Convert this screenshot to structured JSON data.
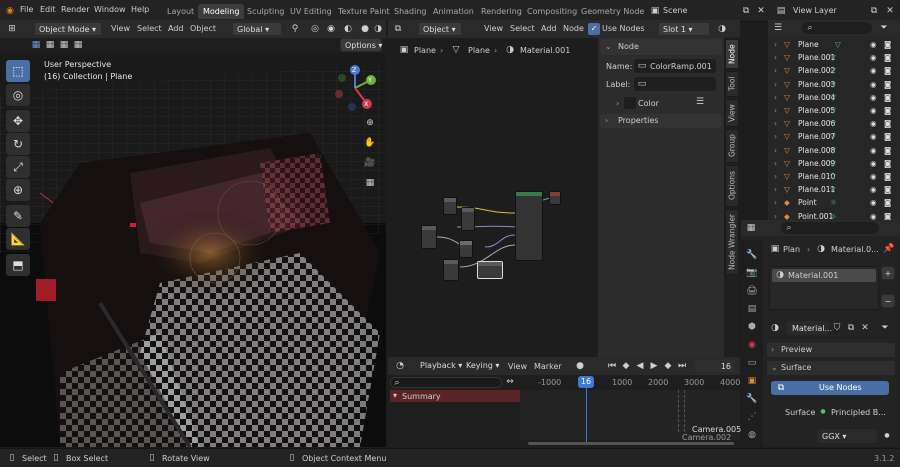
{
  "topbar": {
    "menus": [
      "File",
      "Edit",
      "Render",
      "Window",
      "Help"
    ],
    "workspaces": [
      "Layout",
      "Modeling",
      "Sculpting",
      "UV Editing",
      "Texture Paint",
      "Shading",
      "Animation",
      "Rendering",
      "Compositing",
      "Geometry Node"
    ],
    "active_workspace": "Modeling",
    "scene": "Scene",
    "view_layer": "View Layer"
  },
  "viewport": {
    "mode": "Object Mode",
    "menus": [
      "View",
      "Select",
      "Add",
      "Object"
    ],
    "transform": "Global",
    "options": "Options",
    "overlay_title": "User Perspective",
    "overlay_sub": "(16) Collection | Plane",
    "gizmo": {
      "x": "X",
      "y": "Y",
      "z": "Z"
    }
  },
  "node_editor": {
    "type": "Object",
    "menus": [
      "View",
      "Select",
      "Add",
      "Node"
    ],
    "use_nodes": "Use Nodes",
    "slot": "Slot 1",
    "breadcrumb": [
      "Plane",
      "Plane",
      "Material.001"
    ]
  },
  "npanel": {
    "section": "Node",
    "name_label": "Name:",
    "name_value": "ColorRamp.001",
    "label_label": "Label:",
    "label_value": "",
    "color": "Color",
    "properties": "Properties",
    "tabs": [
      "Node",
      "Tool",
      "View",
      "Group",
      "Options",
      "Node Wrangler"
    ]
  },
  "outliner": {
    "rows": [
      "Plane",
      "Plane.001",
      "Plane.002",
      "Plane.003",
      "Plane.004",
      "Plane.005",
      "Plane.006",
      "Plane.007",
      "Plane.008",
      "Plane.009",
      "Plane.010",
      "Plane.011",
      "Point",
      "Point.001"
    ]
  },
  "properties": {
    "breadcrumb_obj": "Plan",
    "breadcrumb_mat": "Material.0...",
    "slot_item": "Material.001",
    "material_name": "Material...",
    "preview": "Preview",
    "surface": "Surface",
    "use_nodes": "Use Nodes",
    "surface_label": "Surface",
    "surface_value": "Principled B...",
    "distribution": "GGX"
  },
  "timeline": {
    "menus": [
      "Playback",
      "Keying",
      "View",
      "Marker"
    ],
    "current_frame": "16",
    "ruler": [
      "-1000",
      "16",
      "1000",
      "2000",
      "3000",
      "4000"
    ],
    "summary": "Summary",
    "markers": [
      "Camera.005",
      "Camera.002"
    ]
  },
  "status": {
    "items": [
      "Select",
      "Box Select",
      "Rotate View",
      "Object Context Menu"
    ],
    "version": "3.1.2"
  },
  "colors": {
    "accent": "#4a6fa5",
    "selected_frame": "#3d7ad1",
    "summary_bg": "#5a2424",
    "object_orange": "#e08a3c",
    "mesh_green": "#4fc26d"
  }
}
